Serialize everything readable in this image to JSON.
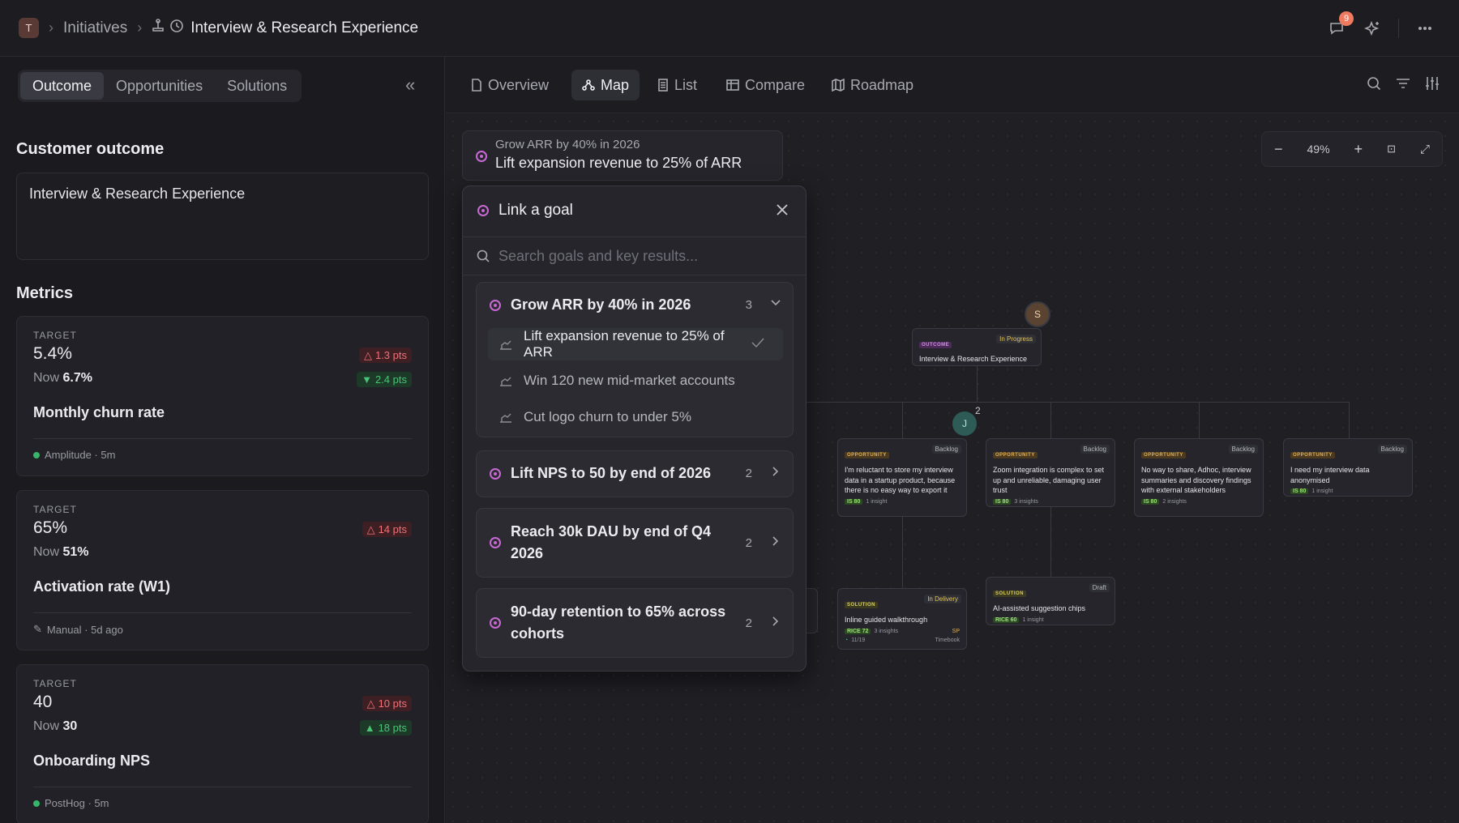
{
  "topbar": {
    "workspace_initial": "T",
    "breadcrumb_initiatives": "Initiatives",
    "breadcrumb_current": "Interview & Research Experience",
    "notification_count": "9"
  },
  "left": {
    "tabs": [
      "Outcome",
      "Opportunities",
      "Solutions"
    ],
    "customer_outcome_heading": "Customer outcome",
    "outcome_text": "Interview & Research Experience",
    "metrics_heading": "Metrics",
    "metrics": [
      {
        "label": "TARGET",
        "target": "5.4%",
        "now_label": "Now",
        "now": "6.7%",
        "delta_target": "1.3 pts",
        "delta_now": "2.4 pts",
        "name": "Monthly churn rate",
        "source": "Amplitude · 5m"
      },
      {
        "label": "TARGET",
        "target": "65%",
        "now_label": "Now",
        "now": "51%",
        "delta_target": "14 pts",
        "name": "Activation rate (W1)",
        "source": "Manual · 5d ago"
      },
      {
        "label": "TARGET",
        "target": "40",
        "now_label": "Now",
        "now": "30",
        "delta_target": "10 pts",
        "delta_now": "18 pts",
        "name": "Onboarding NPS",
        "source": "PostHog · 5m"
      }
    ]
  },
  "toolbar": {
    "tabs": [
      "Overview",
      "Map",
      "List",
      "Compare",
      "Roadmap"
    ],
    "zoom_level": "49%"
  },
  "canvas": {
    "goal_card": {
      "goal": "Grow ARR by 40% in 2026",
      "kr": "Lift expansion revenue to 25% of ARR"
    },
    "outcome_node": {
      "chip": "OUTCOME",
      "status": "In Progress",
      "title": "Interview & Research Experience",
      "avatar": "S"
    },
    "branch_avatar": {
      "initial": "J",
      "count": "2"
    },
    "opportunities": [
      {
        "chip": "OPPORTUNITY",
        "status": "Backlog",
        "title": "I'm reluctant to store my interview data in a startup product, because there is no easy way to export it",
        "score": "IS 80",
        "insights": "1 insight"
      },
      {
        "chip": "OPPORTUNITY",
        "status": "Backlog",
        "title": "Zoom integration is complex to set up and unreliable, damaging user trust",
        "score": "IS 80",
        "insights": "3 insights"
      },
      {
        "chip": "OPPORTUNITY",
        "status": "Backlog",
        "title": "No way to share, Adhoc, interview summaries and discovery findings with external stakeholders",
        "score": "IS 80",
        "insights": "2 insights"
      },
      {
        "chip": "OPPORTUNITY",
        "status": "Backlog",
        "title": "I need my interview data anonymised",
        "score": "IS 80",
        "insights": "1 insight"
      }
    ],
    "solutions": [
      {
        "chip": "SOLUTION",
        "status": "In Delivery",
        "title": "Inline guided walkthrough",
        "score": "RICE 72",
        "insights": "3 insights",
        "progress": "11/19",
        "tag": "Timebook",
        "owner": "SP"
      },
      {
        "chip": "SOLUTION",
        "status": "Draft",
        "title": "AI-assisted suggestion chips",
        "score": "RICE 60",
        "insights": "1 insight"
      }
    ]
  },
  "modal": {
    "title": "Link a goal",
    "search_placeholder": "Search goals and key results...",
    "groups": [
      {
        "title": "Grow ARR by 40% in 2026",
        "count": "3",
        "expanded": true,
        "key_results": [
          "Lift expansion revenue to 25% of ARR",
          "Win 120 new mid-market accounts",
          "Cut logo churn to under 5%"
        ]
      },
      {
        "title": "Lift NPS to 50 by end of 2026",
        "count": "2"
      },
      {
        "title": "Reach 30k DAU by end of Q4 2026",
        "count": "2"
      },
      {
        "title": "90-day retention to 65% across cohorts",
        "count": "2"
      }
    ]
  },
  "colors": {
    "accent_goal": "#c969d6",
    "danger": "#ee7278",
    "success": "#4cc277"
  }
}
